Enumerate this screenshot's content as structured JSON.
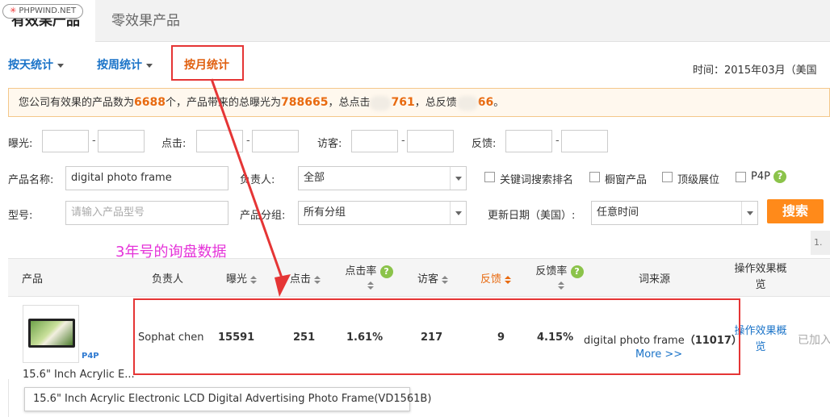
{
  "watermark": "PHPWIND.NET",
  "tabs": {
    "active": "有效果产品",
    "inactive": "零效果产品"
  },
  "stats": {
    "by_day": "按天统计",
    "by_week": "按周统计",
    "by_month": "按月统计"
  },
  "time_label": "时间：2015年03月（美国",
  "summary": {
    "part1": "您公司有效果的产品数为",
    "product_count": "6688",
    "part2": "个，产品带来的总曝光为",
    "exposure": "788665",
    "part3": "，总点击",
    "clicks": "761",
    "part4": "，总反馈",
    "feedback": "66",
    "part5": "。"
  },
  "filters": {
    "exposure": "曝光:",
    "clicks": "点击:",
    "visitors": "访客:",
    "feedback": "反馈:",
    "dash": "-",
    "product_name_label": "产品名称:",
    "product_name_value": "digital photo frame",
    "owner_label": "负责人:",
    "owner_value": "全部",
    "keyword_rank": "关键词搜索排名",
    "showcase": "橱窗产品",
    "top_booth": "顶级展位",
    "p4p": "P4P",
    "model_label": "型号:",
    "model_placeholder": "请输入产品型号",
    "group_label": "产品分组:",
    "group_value": "所有分组",
    "update_label": "更新日期（美国）:",
    "update_value": "任意时间",
    "search_button": "搜索"
  },
  "annotation": "3年号的询盘数据",
  "scroll_stub": "1.",
  "table": {
    "headers": {
      "product": "产品",
      "owner": "负责人",
      "exposure": "曝光",
      "clicks": "点击",
      "ctr": "点击率",
      "visitors": "访客",
      "feedback": "反馈",
      "feedback_rate": "反馈率",
      "keyword_source": "词来源",
      "operation_line1": "操作效果概",
      "operation_line2": "览"
    },
    "row": {
      "p4p_badge": "P4P",
      "title_short": "15.6\" Inch Acrylic E...",
      "owner": "Sophat chen",
      "exposure": "15591",
      "clicks": "251",
      "ctr": "1.61%",
      "visitors": "217",
      "feedback": "9",
      "feedback_rate": "4.15%",
      "keyword": "digital photo frame",
      "keyword_count": "（11017）",
      "more": "More >>",
      "op_line1": "操作效果概",
      "op_line2": "览",
      "added": "已加入"
    },
    "tooltip": "15.6\" Inch Acrylic Electronic LCD Digital Advertising Photo Frame(VD1561B)"
  },
  "colors": {
    "accent_orange": "#e86a10",
    "link_blue": "#1a73c8",
    "annotation_red": "#e53535",
    "annotation_magenta": "#e533d9"
  }
}
